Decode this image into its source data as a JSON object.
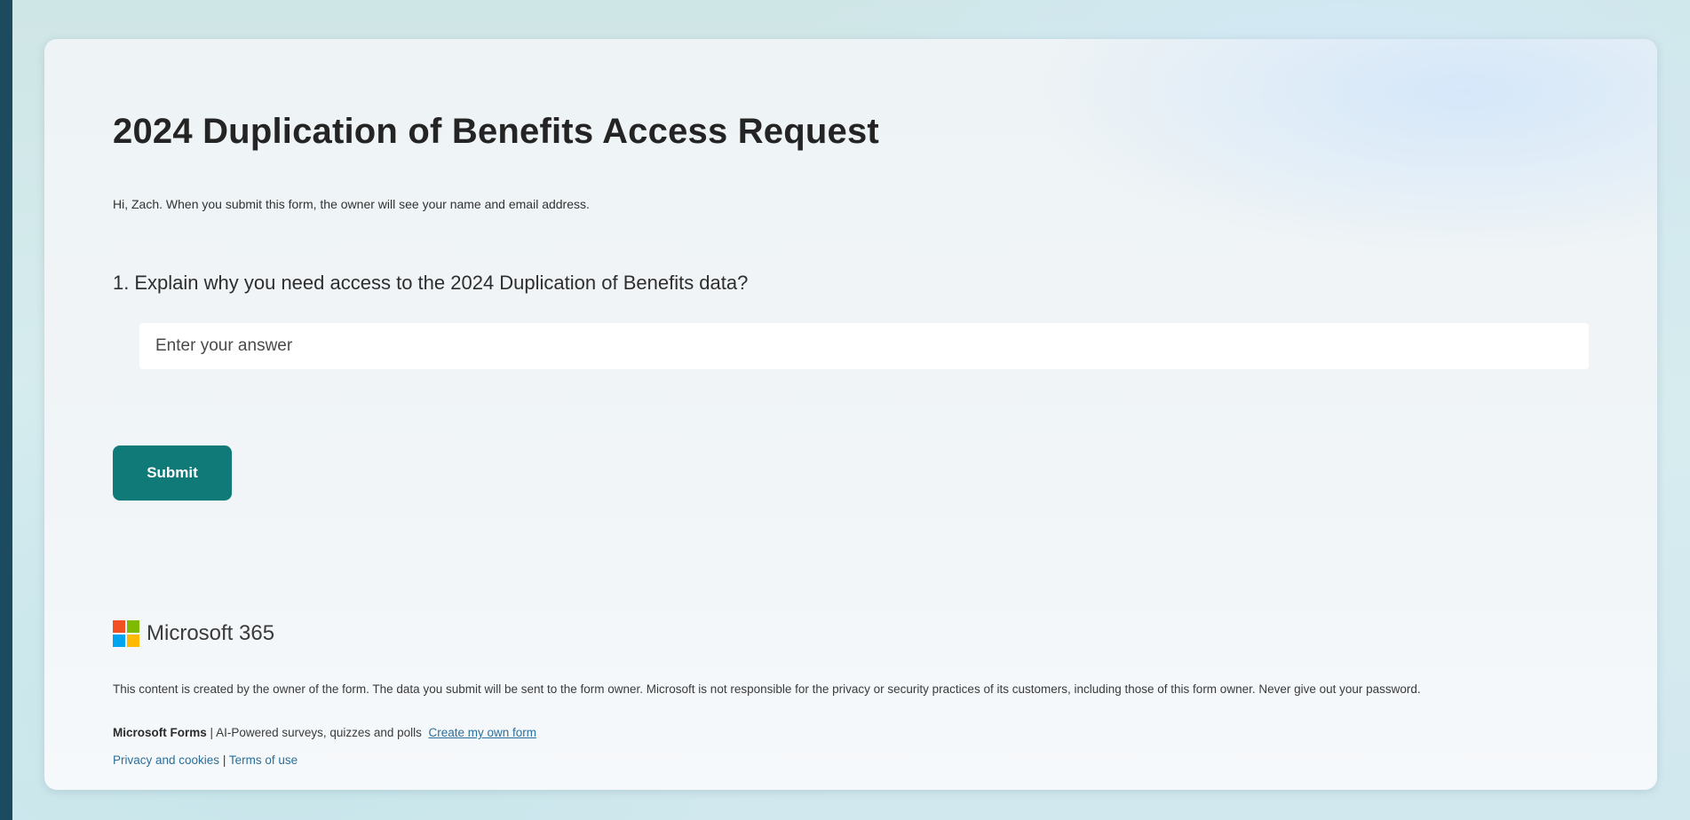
{
  "form": {
    "title": "2024 Duplication of Benefits Access Request",
    "greeting": "Hi, Zach. When you submit this form, the owner will see your name and email address.",
    "question": {
      "number": "1.",
      "text": "Explain why you need access to the 2024 Duplication of Benefits data?"
    },
    "answer": {
      "value": "",
      "placeholder": "Enter your answer"
    },
    "submit_label": "Submit"
  },
  "footer": {
    "brand_name": "Microsoft 365",
    "logo_colors": [
      "#f25022",
      "#7fba00",
      "#00a4ef",
      "#ffb900"
    ],
    "disclaimer": "This content is created by the owner of the form. The data you submit will be sent to the form owner. Microsoft is not responsible for the privacy or security practices of its customers, including those of this form owner. Never give out your password.",
    "forms_name": "Microsoft Forms",
    "separator": "|",
    "forms_tagline": "AI-Powered surveys, quizzes and polls",
    "create_link": "Create my own form",
    "privacy_link": "Privacy and cookies",
    "terms_link": "Terms of use"
  },
  "colors": {
    "submit_button": "#0f7a78",
    "link": "#2a6f9b",
    "outer_frame": "#1c4a5e"
  }
}
